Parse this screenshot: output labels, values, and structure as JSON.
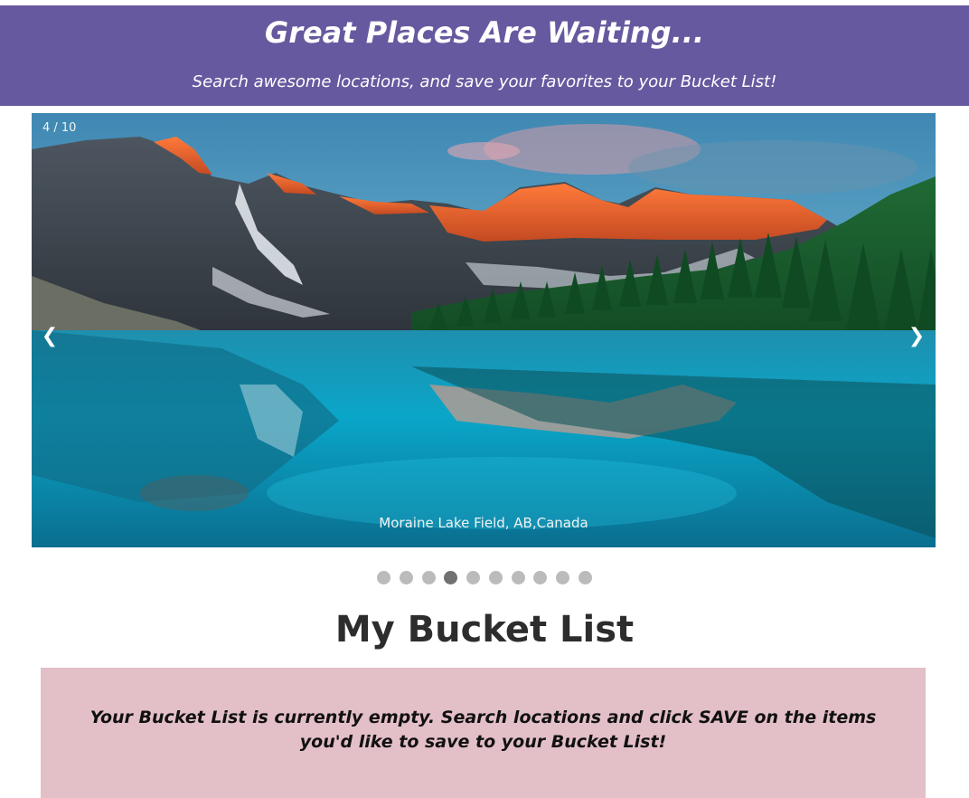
{
  "header": {
    "title": "Great Places Are Waiting...",
    "subtitle": "Search awesome locations, and save your favorites to your Bucket List!",
    "background_color": "#67599f"
  },
  "slideshow": {
    "counter": "4 / 10",
    "caption": "Moraine Lake Field, AB,Canada",
    "prev_label": "❮",
    "next_label": "❯",
    "current_slide": 4,
    "total_slides": 10,
    "image": "mountain-lake-landscape",
    "prev_icon": "chevron-left-icon",
    "next_icon": "chevron-right-icon"
  },
  "bucket_list": {
    "title": "My Bucket List",
    "empty_message": "Your Bucket List is currently empty. Search locations and click SAVE on the items you'd like to save to your Bucket List!",
    "box_color": "#e3bfc8"
  },
  "colors": {
    "dot_inactive": "#bbbbbb",
    "dot_active": "#717171"
  }
}
